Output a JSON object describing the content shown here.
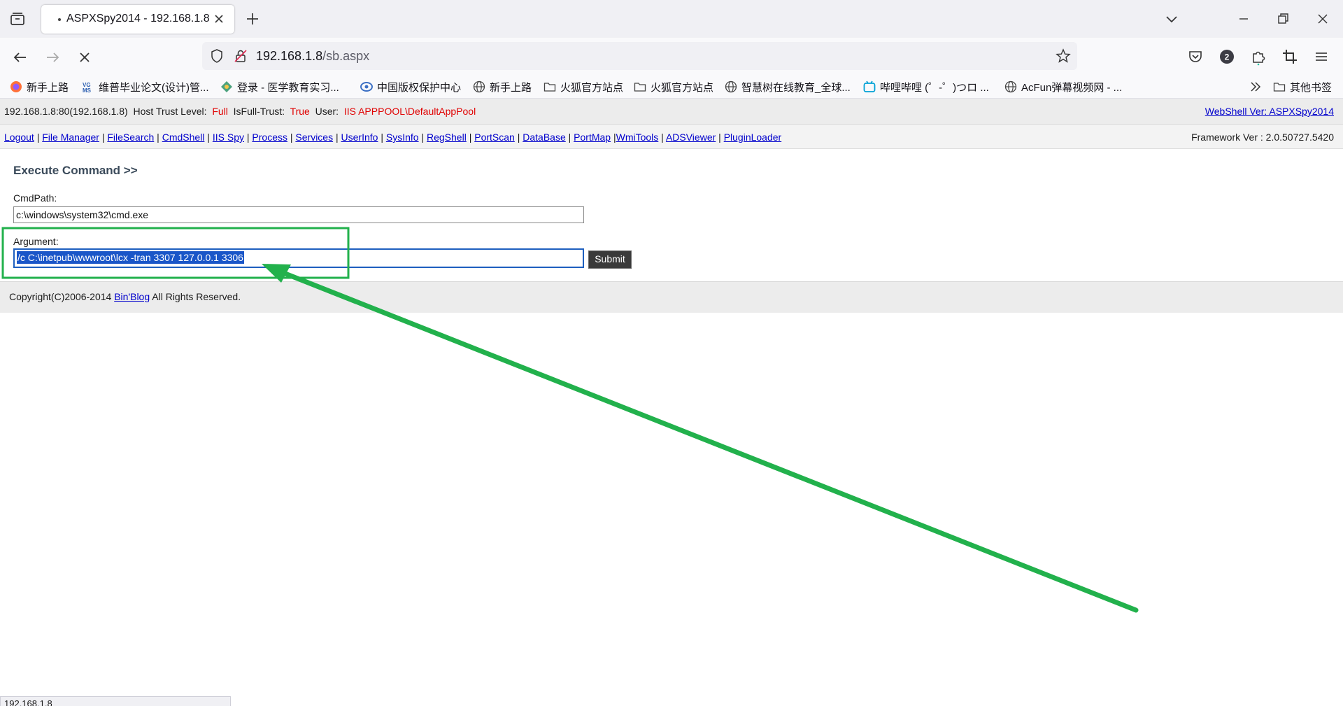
{
  "browser": {
    "tab_title": "ASPXSpy2014 - 192.168.1.8",
    "url_host": "192.168.1.8",
    "url_path": "/sb.aspx",
    "extensions_badge": "2",
    "bookmarks": [
      {
        "label": "新手上路",
        "icon": "firefox-icon"
      },
      {
        "label": "维普毕业论文(设计)管...",
        "icon": "vgms-icon"
      },
      {
        "label": "登录 - 医学教育实习...",
        "icon": "site-icon"
      },
      {
        "label": "中国版权保护中心",
        "icon": "site-icon"
      },
      {
        "label": "新手上路",
        "icon": "globe-icon"
      },
      {
        "label": "火狐官方站点",
        "icon": "folder-icon"
      },
      {
        "label": "火狐官方站点",
        "icon": "folder-icon"
      },
      {
        "label": "智慧树在线教育_全球...",
        "icon": "globe-icon"
      },
      {
        "label": "哔哩哔哩 (゜-゜)つロ ...",
        "icon": "bilibili-icon"
      },
      {
        "label": "AcFun弹幕视频网 - ...",
        "icon": "globe-icon"
      }
    ],
    "other_bookmarks": "其他书签"
  },
  "infobar": {
    "host": "192.168.1.8:80(192.168.1.8)",
    "trust_label": "Host Trust Level:",
    "trust_value": "Full",
    "fulltrust_label": "IsFull-Trust:",
    "fulltrust_value": "True",
    "user_label": "User:",
    "user_value": "IIS APPPOOL\\DefaultAppPool",
    "version_link": "WebShell Ver: ASPXSpy2014"
  },
  "menu": {
    "items": [
      "Logout",
      "File Manager",
      "FileSearch",
      "CmdShell",
      "IIS Spy",
      "Process",
      "Services",
      "UserInfo",
      "SysInfo",
      "RegShell",
      "PortScan",
      "DataBase",
      "PortMap",
      "WmiTools",
      "ADSViewer",
      "PluginLoader"
    ],
    "framework": "Framework Ver : 2.0.50727.5420"
  },
  "form": {
    "title": "Execute Command >>",
    "cmdpath_label": "CmdPath:",
    "cmdpath_value": "c:\\windows\\system32\\cmd.exe",
    "argument_label": "Argument:",
    "argument_value": "/c C:\\inetpub\\wwwroot\\lcx -tran 3307 127.0.0.1 3306",
    "submit_label": "Submit"
  },
  "footer": {
    "prefix": "Copyright(C)2006-2014 ",
    "link": "Bin'Blog",
    "suffix": " All Rights Reserved."
  },
  "statusbar": "192.168.1.8",
  "annotation_color": "#22b14c"
}
